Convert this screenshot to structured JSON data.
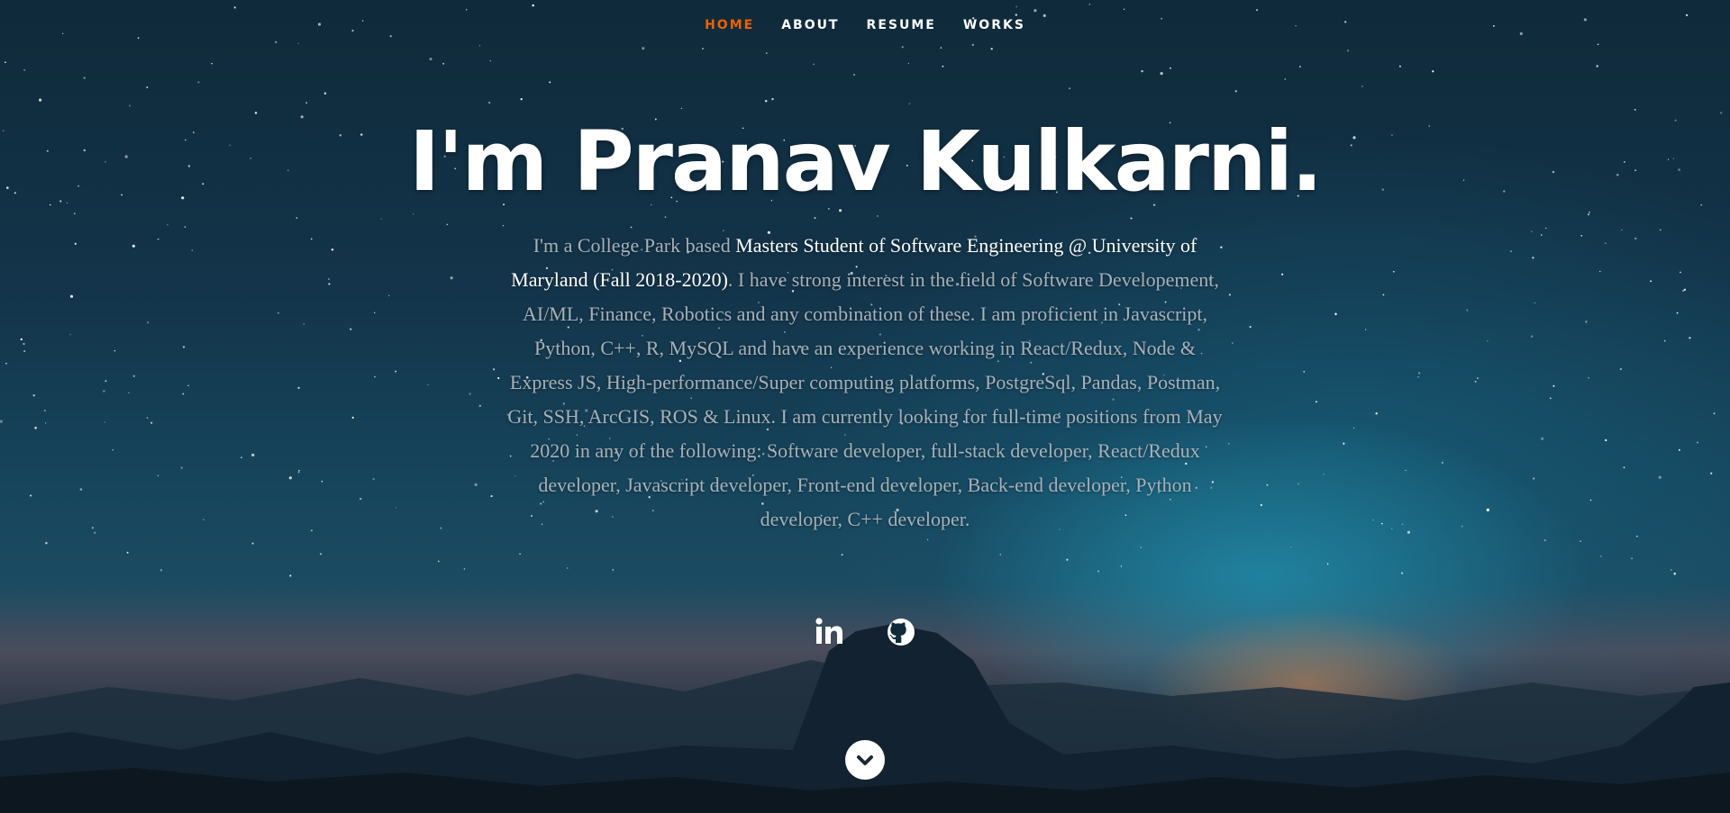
{
  "nav": {
    "items": [
      {
        "label": "HOME",
        "active": true
      },
      {
        "label": "ABOUT",
        "active": false
      },
      {
        "label": "RESUME",
        "active": false
      },
      {
        "label": "WORKS",
        "active": false
      }
    ],
    "active_color": "#f06000"
  },
  "hero": {
    "title": "I'm Pranav Kulkarni.",
    "bio_intro": "I'm a College Park based ",
    "bio_highlight": "Masters Student of Software Engineering @ University of Maryland (Fall 2018-2020)",
    "bio_rest": ". I have strong interest in the field of Software Developement, AI/ML, Finance, Robotics and any combination of these. I am proficient in Javascript, Python, C++, R, MySQL and have an experience working in React/Redux, Node & Express JS, High-performance/Super computing platforms, PostgreSql, Pandas, Postman, Git, SSH, ArcGIS, ROS & Linux. I am currently looking for full-time positions from May 2020 in any of the following: Software developer, full-stack developer, React/Redux developer, Javascript developer, Front-end developer, Back-end developer, Python developer, C++ developer."
  },
  "social": {
    "linkedin_icon": "linkedin-icon",
    "github_icon": "github-icon"
  },
  "scroll": {
    "icon": "chevron-down-icon"
  }
}
